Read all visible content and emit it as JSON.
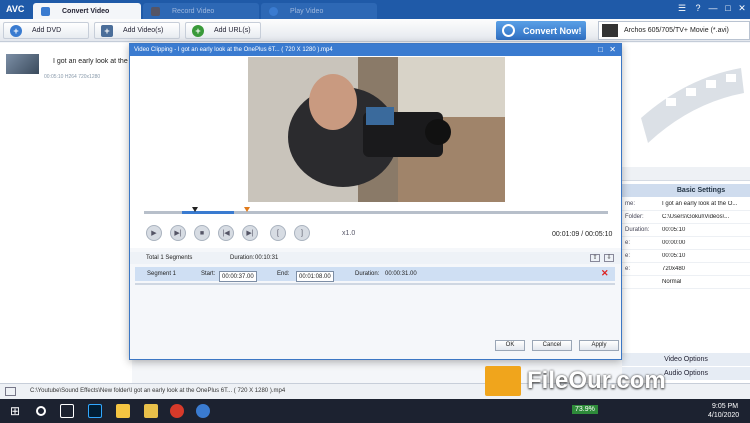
{
  "app": {
    "logo": "AVC"
  },
  "tabs": [
    {
      "label": "Convert Video"
    },
    {
      "label": "Record Video"
    },
    {
      "label": "Play Video"
    }
  ],
  "window": {
    "menu_icon": "☰",
    "minimize": "—",
    "maximize": "□",
    "close": "✕"
  },
  "toolbar": {
    "add_dvd": "Add DVD",
    "add_videos": "Add Video(s)",
    "add_urls": "Add URL(s)",
    "convert": "Convert Now!",
    "profile": "Archos 605/705/TV+ Movie (*.avi)"
  },
  "file": {
    "name": "I got an early look at the OnePlus 6T...",
    "meta": "00:05:10   H264   720x1280"
  },
  "dialog": {
    "title": "Video Clipping - I got an early look at the OnePlus 6T... ( 720 X 1280 ).mp4",
    "time_current": "00:01:09",
    "time_total": "00:05:10",
    "time_sep": "/",
    "speed": "x1.0",
    "total_segments": "Total 1 Segments",
    "total_duration_label": "Duration:",
    "total_duration": "00:10:31",
    "segment": {
      "name": "Segment 1",
      "start_label": "Start:",
      "start": "00:00:37.00",
      "end_label": "End:",
      "end": "00:01:08.00",
      "duration_label": "Duration:",
      "duration": "00:00:31.00"
    },
    "ok": "OK",
    "cancel": "Cancel",
    "apply": "Apply"
  },
  "right": {
    "basic_settings": "Basic Settings",
    "rows": [
      {
        "key": "me:",
        "value": "I got an early look at the O..."
      },
      {
        "key": "Folder:",
        "value": "C:\\Users\\Gokul\\Videos\\..."
      },
      {
        "key": "Duration:",
        "value": "00:05:10"
      },
      {
        "key": "e:",
        "value": "00:00:00"
      },
      {
        "key": "e:",
        "value": "00:05:10"
      },
      {
        "key": "e:",
        "value": "720x480"
      },
      {
        "key": "",
        "value": "Normal"
      }
    ],
    "video_options": "Video Options",
    "audio_options": "Audio Options"
  },
  "status": {
    "path": "C:\\Youtube\\Sound Effects\\New folder\\I got an early look at the OnePlus 6T... ( 720 X 1280 ).mp4"
  },
  "taskbar": {
    "battery": "73.9%",
    "time": "9:05 PM",
    "date": "4/10/2020"
  },
  "watermark": {
    "text": "FileOur.com"
  },
  "colors": {
    "titlebar": "#1f5aa8",
    "accent": "#3a7bd0",
    "marker": "#e07a1a",
    "watermark": "#f0a51c"
  }
}
